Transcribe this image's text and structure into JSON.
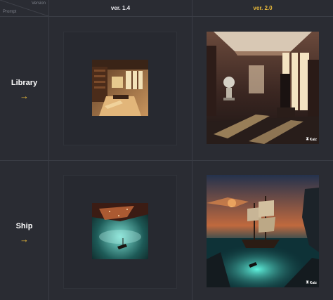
{
  "header": {
    "corner_version": "Version",
    "corner_prompt": "Prompt",
    "columns": [
      "ver. 1.4",
      "ver. 2.0"
    ]
  },
  "rows": [
    {
      "label": "Library",
      "arrow": "→"
    },
    {
      "label": "Ship",
      "arrow": "→"
    }
  ],
  "watermark": {
    "mark": "⧗",
    "text": "Kaiz"
  },
  "colors": {
    "accent": "#e8b93a",
    "background": "#2a2c33",
    "grid": "#3a3d45"
  },
  "icons": {
    "arrow": "arrow-right-icon",
    "watermark": "hourglass-icon"
  }
}
